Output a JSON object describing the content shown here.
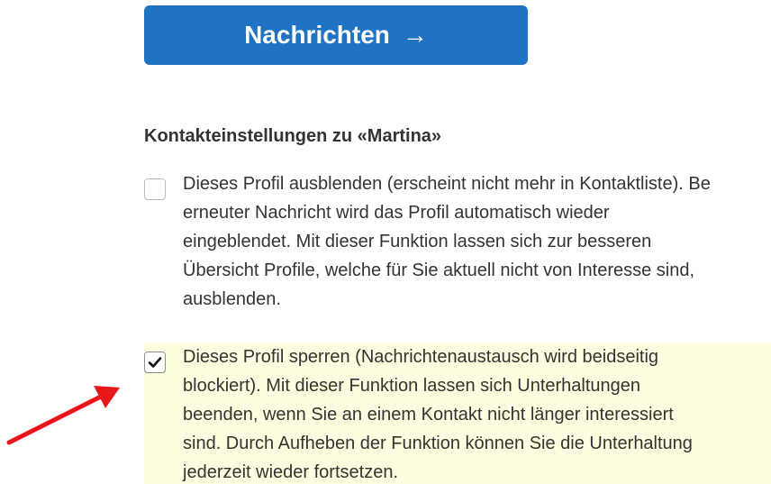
{
  "button": {
    "label": "Nachrichten",
    "arrow": "→"
  },
  "section": {
    "title": "Kontakteinstellungen zu «Martina»"
  },
  "options": [
    {
      "checked": false,
      "lines": [
        "Dieses Profil ausblenden (erscheint nicht mehr in Kontaktliste). Be",
        "erneuter Nachricht wird das Profil automatisch wieder",
        "eingeblendet. Mit dieser Funktion lassen sich zur besseren",
        "Übersicht Profile, welche für Sie aktuell nicht von Interesse sind,",
        "ausblenden."
      ]
    },
    {
      "checked": true,
      "lines": [
        "Dieses Profil sperren (Nachrichtenaustausch wird beidseitig",
        "blockiert). Mit dieser Funktion lassen sich Unterhaltungen",
        "beenden, wenn Sie an einem Kontakt nicht länger interessiert",
        "sind. Durch Aufheben der Funktion können Sie die Unterhaltung",
        "jederzeit wieder fortsetzen."
      ]
    }
  ],
  "colors": {
    "button": "#1f73c2",
    "highlight": "#fefde0",
    "annotation_arrow": "#e8171b"
  }
}
